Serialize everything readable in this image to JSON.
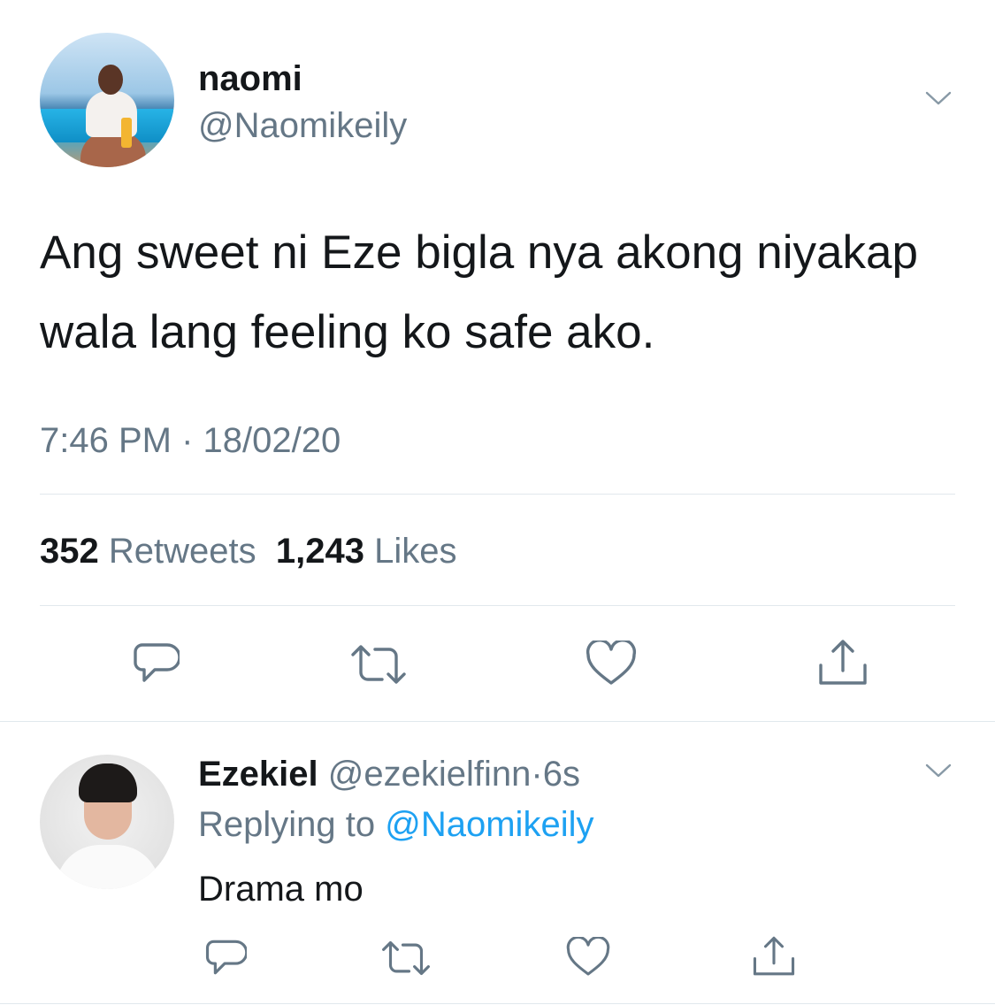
{
  "tweet": {
    "display_name": "naomi",
    "handle": "@Naomikeily",
    "text": "Ang sweet ni Eze bigla nya akong niyakap wala lang feeling ko safe ako.",
    "timestamp": "7:46 PM · 18/02/20",
    "stats": {
      "retweets_count": "352",
      "retweets_label": "Retweets",
      "likes_count": "1,243",
      "likes_label": "Likes"
    }
  },
  "reply": {
    "display_name": "Ezekiel",
    "handle": "@ezekielfinn",
    "separator": "·",
    "time": "6s",
    "replying_label": "Replying to",
    "replying_mention": "@Naomikeily",
    "text": "Drama mo"
  },
  "icons": {
    "reply": "reply-icon",
    "retweet": "retweet-icon",
    "like": "heart-icon",
    "share": "share-icon",
    "more": "chevron-down-icon"
  },
  "colors": {
    "text": "#14171a",
    "secondary": "#657786",
    "link": "#1da1f2",
    "divider": "#e1e8ed",
    "icon": "#657786"
  }
}
